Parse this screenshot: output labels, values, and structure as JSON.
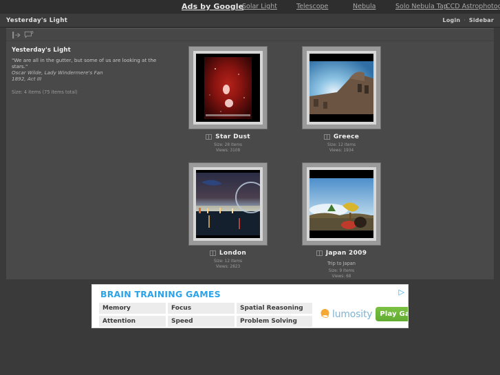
{
  "ads_bar": {
    "label": "Ads by Google",
    "links": [
      "Solar Light",
      "Telescope",
      "Nebula",
      "Solo Nebula Tap",
      "CCD Astrophotography"
    ]
  },
  "header": {
    "site_title": "Yesterday's Light",
    "login_label": "Login",
    "separator": "·",
    "sidebar_label": "Sidebar"
  },
  "toolbar": {
    "icons": [
      "slideshow-icon",
      "comment-icon"
    ]
  },
  "sidebar": {
    "album_title": "Yesterday's Light",
    "quote": "\"We are all in the gutter, but some of us are looking at the stars.\"",
    "attribution": "Oscar Wilde, Lady Windermere's Fan",
    "attribution2": "1892, Act III",
    "size": "Size: 4 items (75 items total)"
  },
  "albums": [
    {
      "title": "Star Dust",
      "desc": "",
      "size": "Size: 28 items",
      "views": "Views: 3108",
      "icon": "album-book-icon"
    },
    {
      "title": "Greece",
      "desc": "",
      "size": "Size: 12 items",
      "views": "Views: 1934",
      "icon": "album-book-icon"
    },
    {
      "title": "London",
      "desc": "",
      "size": "Size: 12 items",
      "views": "Views: 2823",
      "icon": "album-book-icon"
    },
    {
      "title": "Japan 2009",
      "desc": "Trip to Japan",
      "size": "Size: 9 items",
      "views": "Views: 68",
      "icon": "album-book-icon"
    }
  ],
  "bottom_ad": {
    "heading": "BRAIN TRAINING GAMES",
    "arrow": "▷",
    "columns": [
      [
        "Memory",
        "Attention"
      ],
      [
        "Focus",
        "Speed"
      ],
      [
        "Spatial Reasoning",
        "Problem Solving"
      ]
    ],
    "brand": "lumosity",
    "cta": "Play Games"
  },
  "colors": {
    "page_bg": "#3a3a3a",
    "panel_bg": "#494949",
    "ad_accent": "#2aa3e8",
    "cta_green": "#7ac143"
  }
}
